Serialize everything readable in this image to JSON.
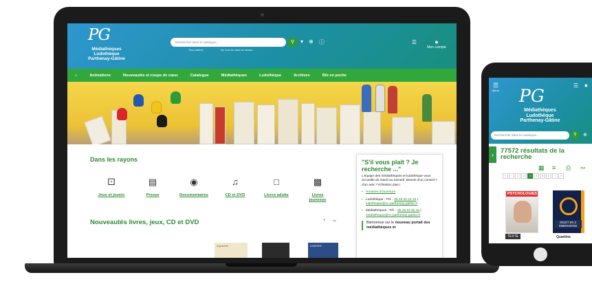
{
  "site": {
    "logo_mark": "PG",
    "logo_lines": [
      "Médiathèques",
      "Ludothèque",
      "Parthenay-Gâtine"
    ],
    "search_placeholder": "Rechercher dans le catalogue...",
    "sub_links": [
      "Tous critères",
      "Sur tous les sites de réseau"
    ],
    "account_label": "Mon compte"
  },
  "nav": {
    "items": [
      "Animations",
      "Nouveautés et coups de cœur",
      "Catalogue",
      "Médiathèques",
      "Ludothèque",
      "Archives",
      "Bib en poche"
    ]
  },
  "rayons": {
    "title": "Dans les rayons",
    "items": [
      {
        "label": "Jeux et jouets",
        "icon": "dice-icon"
      },
      {
        "label": "Presse",
        "icon": "newspaper-icon"
      },
      {
        "label": "Documentaires",
        "icon": "globe-icon"
      },
      {
        "label": "CD et DVD",
        "icon": "disc-icon"
      },
      {
        "label": "Livres adulte",
        "icon": "book-icon"
      },
      {
        "label": "Livres jeunesse",
        "icon": "kids-book-icon"
      }
    ]
  },
  "nouveautes": {
    "title": "Nouveautés livres, jeux, CD et DVD",
    "thumb_text": [
      "Aquarelle",
      "CONTES"
    ]
  },
  "panel": {
    "title": "\"S'il vous plaît ? Je recherche ...\"",
    "intro": "L'équipe des médiathèques et ludothèque vous accueille du mardi au samedi. Besoin d'un conseil ? d'un avis ? N'hésitez plus !",
    "hours_link": "Horaires d'ouverture",
    "ludo_label": "Ludothèque : Tél. :",
    "ludo_phone": "05 49 94 24 43",
    "ludo_mail": "ludotheque@cc-parthenay-gatine.fr",
    "media_label": "Médiathèques : Tél. :",
    "media_phone": "05 49 94 90 42",
    "media_mail": "mediatheque@cc-parthenay-gatine.fr",
    "welcome_pre": "Bienvenue sur le",
    "welcome_bold": "nouveau portail des médiathèques et"
  },
  "tablet": {
    "menu_label": "Menu",
    "results": "77572 résultats de la recherche",
    "pages": [
      "«",
      "‹",
      "1",
      "2",
      "3",
      "4",
      "5",
      "6",
      "›",
      "»"
    ],
    "active_page": "3",
    "cover1_title": "PSYCHOLOGIES",
    "cover1_tag": "TEXTE",
    "cover2_tag": "OBJET EN 3 DIMENSIONS",
    "cover2_title": "Quartino"
  },
  "colors": {
    "header_blue": "#2e97cf",
    "header_teal": "#188f7f",
    "nav_green": "#32a83c",
    "accent_green": "#2d8a33"
  }
}
